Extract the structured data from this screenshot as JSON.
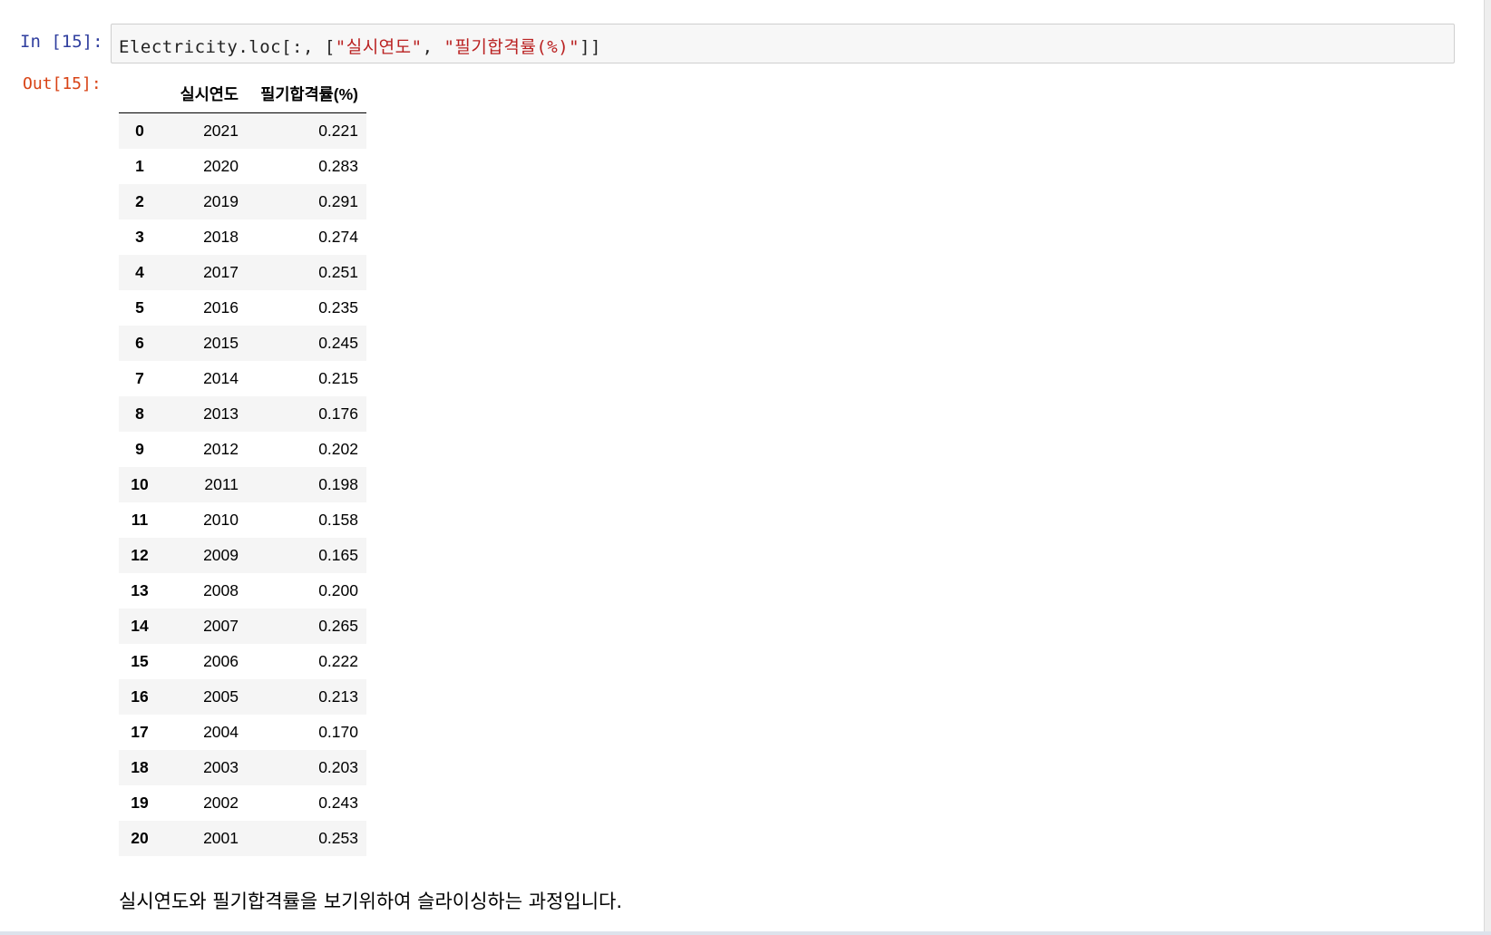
{
  "input_cell": {
    "prompt": "In [15]:",
    "code_prefix": "Electricity.loc[:, [",
    "code_str1": "\"실시연도\"",
    "code_sep": ", ",
    "code_str2": "\"필기합격률(%)\"",
    "code_suffix": "]]"
  },
  "output_cell": {
    "prompt": "Out[15]:",
    "table": {
      "columns": [
        "",
        "실시연도",
        "필기합격률(%)"
      ],
      "rows": [
        {
          "index": "0",
          "year": "2021",
          "rate": "0.221"
        },
        {
          "index": "1",
          "year": "2020",
          "rate": "0.283"
        },
        {
          "index": "2",
          "year": "2019",
          "rate": "0.291"
        },
        {
          "index": "3",
          "year": "2018",
          "rate": "0.274"
        },
        {
          "index": "4",
          "year": "2017",
          "rate": "0.251"
        },
        {
          "index": "5",
          "year": "2016",
          "rate": "0.235"
        },
        {
          "index": "6",
          "year": "2015",
          "rate": "0.245"
        },
        {
          "index": "7",
          "year": "2014",
          "rate": "0.215"
        },
        {
          "index": "8",
          "year": "2013",
          "rate": "0.176"
        },
        {
          "index": "9",
          "year": "2012",
          "rate": "0.202"
        },
        {
          "index": "10",
          "year": "2011",
          "rate": "0.198"
        },
        {
          "index": "11",
          "year": "2010",
          "rate": "0.158"
        },
        {
          "index": "12",
          "year": "2009",
          "rate": "0.165"
        },
        {
          "index": "13",
          "year": "2008",
          "rate": "0.200"
        },
        {
          "index": "14",
          "year": "2007",
          "rate": "0.265"
        },
        {
          "index": "15",
          "year": "2006",
          "rate": "0.222"
        },
        {
          "index": "16",
          "year": "2005",
          "rate": "0.213"
        },
        {
          "index": "17",
          "year": "2004",
          "rate": "0.170"
        },
        {
          "index": "18",
          "year": "2003",
          "rate": "0.203"
        },
        {
          "index": "19",
          "year": "2002",
          "rate": "0.243"
        },
        {
          "index": "20",
          "year": "2001",
          "rate": "0.253"
        }
      ]
    }
  },
  "markdown_cell": {
    "text": "실시연도와 필기합격률을 보기위하여 슬라이싱하는 과정입니다."
  },
  "colors": {
    "in_prompt": "#303f9f",
    "out_prompt": "#d84315",
    "string_literal": "#ba2121",
    "code_background": "#f7f7f7",
    "row_stripe": "#f5f5f5"
  }
}
